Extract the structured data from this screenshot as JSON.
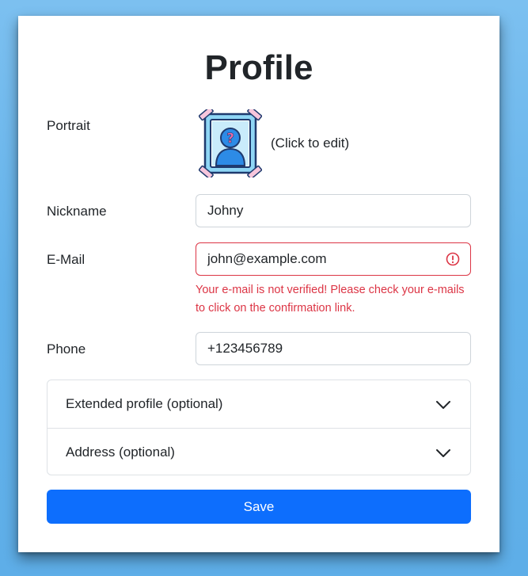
{
  "form": {
    "title": "Profile",
    "portrait": {
      "label": "Portrait",
      "hint": "(Click to edit)",
      "icon": "portrait-placeholder-icon"
    },
    "nickname": {
      "label": "Nickname",
      "value": "Johny"
    },
    "email": {
      "label": "E-Mail",
      "value": "john@example.com",
      "error": "Your e-mail is not verified! Please check your e-mails to click on the confirmation link.",
      "icon": "error-circle-icon"
    },
    "phone": {
      "label": "Phone",
      "value": "+123456789"
    },
    "accordion": [
      {
        "label": "Extended profile (optional)",
        "icon": "chevron-down-icon"
      },
      {
        "label": "Address (optional)",
        "icon": "chevron-down-icon"
      }
    ],
    "save_label": "Save"
  },
  "colors": {
    "background": "#63b2ea",
    "primary": "#0d6efd",
    "danger": "#dc3545",
    "border": "#ced4da"
  }
}
